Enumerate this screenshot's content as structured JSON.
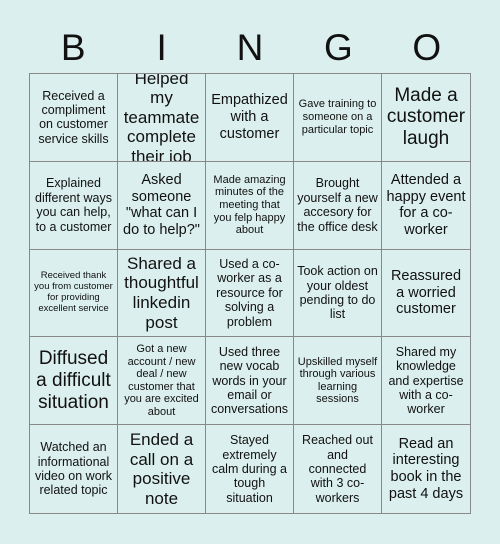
{
  "header": {
    "letters": [
      "B",
      "I",
      "N",
      "G",
      "O"
    ]
  },
  "cells": [
    {
      "text": "Received a compliment on customer service skills",
      "size": "s-md"
    },
    {
      "text": "Helped my teammate complete their job",
      "size": "s-xl"
    },
    {
      "text": "Empathized with a customer",
      "size": "s-lg"
    },
    {
      "text": "Gave training to someone on a particular topic",
      "size": "s-sm"
    },
    {
      "text": "Made a customer laugh",
      "size": "s-xxl"
    },
    {
      "text": "Explained different ways you can help, to a customer",
      "size": "s-md"
    },
    {
      "text": "Asked someone \"what can I do to help?\"",
      "size": "s-lg"
    },
    {
      "text": "Made amazing minutes of the meeting that you felp happy about",
      "size": "s-sm"
    },
    {
      "text": "Brought yourself a new accesory for the office desk",
      "size": "s-md"
    },
    {
      "text": "Attended a happy event for a co-worker",
      "size": "s-lg"
    },
    {
      "text": "Received thank you from customer for providing excellent service",
      "size": "s-xs"
    },
    {
      "text": "Shared a thoughtful linkedin post",
      "size": "s-xl"
    },
    {
      "text": "Used a co-worker as a resource for solving a problem",
      "size": "s-md"
    },
    {
      "text": "Took action on your oldest pending to do list",
      "size": "s-md"
    },
    {
      "text": "Reassured a worried customer",
      "size": "s-lg"
    },
    {
      "text": "Diffused a difficult situation",
      "size": "s-xxl"
    },
    {
      "text": "Got a new account / new deal / new customer that you are excited about",
      "size": "s-sm"
    },
    {
      "text": "Used three new vocab words in your email or conversations",
      "size": "s-md"
    },
    {
      "text": "Upskilled myself through various learning sessions",
      "size": "s-sm"
    },
    {
      "text": "Shared my knowledge and expertise with a co-worker",
      "size": "s-md"
    },
    {
      "text": "Watched an informational video on work related topic",
      "size": "s-md"
    },
    {
      "text": "Ended a call on a positive note",
      "size": "s-xl"
    },
    {
      "text": "Stayed extremely calm during a tough situation",
      "size": "s-md"
    },
    {
      "text": "Reached out and connected with 3 co-workers",
      "size": "s-md"
    },
    {
      "text": "Read an interesting book in the past 4 days",
      "size": "s-lg"
    }
  ]
}
